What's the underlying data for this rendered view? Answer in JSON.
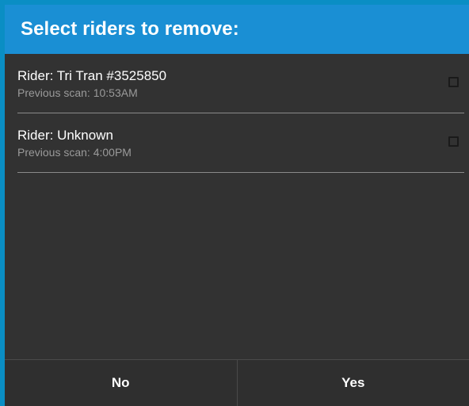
{
  "dialog": {
    "title": "Select riders to remove:",
    "riders": [
      {
        "name": "Rider: Tri Tran #3525850",
        "previous_scan": "Previous scan: 10:53AM",
        "checked": false
      },
      {
        "name": "Rider: Unknown",
        "previous_scan": "Previous scan: 4:00PM",
        "checked": false
      }
    ],
    "buttons": {
      "no_label": "No",
      "yes_label": "Yes"
    }
  },
  "colors": {
    "header": "#1a8fd4",
    "background": "#323232",
    "frame": "#0a8ec4"
  }
}
